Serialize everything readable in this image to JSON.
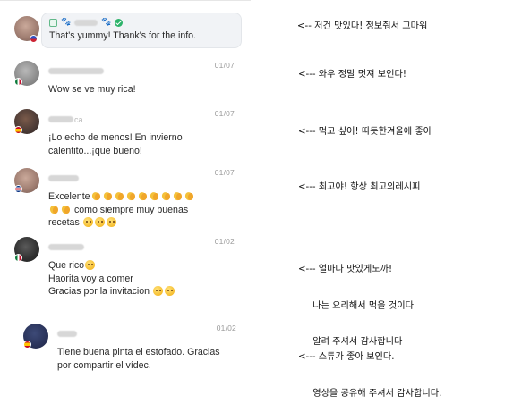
{
  "comments": [
    {
      "date": "",
      "text": "That's yummy! Thank's for the info.",
      "annotation": "<-- 저건 맛있다! 정보줘서 고마워"
    },
    {
      "date": "01/07",
      "text": "Wow se ve muy rica!",
      "annotation": "<--- 와우 정말 멋져 보인다!"
    },
    {
      "name_suffix": "ca",
      "date": "01/07",
      "text_line1": "¡Lo echo de menos! En invierno",
      "text_line2": "calentito...¡que bueno!",
      "annotation": "<--- 먹고 싶어! 따듯한겨울에 좋아"
    },
    {
      "date": "01/07",
      "text_part1": "Excelente",
      "text_part2": "como siempre muy buenas",
      "text_part3": "recetas",
      "annotation": "<--- 최고야! 항상 최고의레시피"
    },
    {
      "date": "01/02",
      "text_line1": "Que rico",
      "text_line2": "Haorita voy a comer",
      "text_line3": "Gracias por la invitacion",
      "annotation_line1": "<--- 얼마나 맛있게노까!",
      "annotation_line2": "     나는 요리해서 먹을 것이다",
      "annotation_line3": "     알려 주셔서 감사합니다"
    },
    {
      "date": "01/02",
      "text_line1": "Tiene buena pinta el estofado. Gracias",
      "text_line2": "por compartir el vídec.",
      "annotation_line1": "<--- 스튜가 좋아 보인다.",
      "annotation_line2": "     영상을 공유해 주셔서 감사합니다."
    }
  ],
  "emoji_names": [
    "clapping-hands",
    "smiling-face"
  ],
  "colors": {
    "highlight_bg": "#f1f3f6",
    "date_text": "#9a9a9a",
    "verified_badge": "#2db36a"
  }
}
